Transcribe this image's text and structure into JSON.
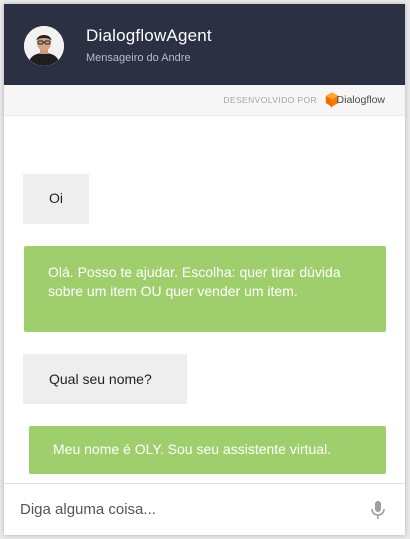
{
  "header": {
    "agent_name": "DialogflowAgent",
    "subtitle": "Mensageiro do Andre",
    "background_color": "#2b3142",
    "avatar_icon": "user-photo-avatar"
  },
  "powered_by": {
    "label": "DESENVOLVIDO POR",
    "brand": "Dialogflow",
    "brand_color": "#ef6c00"
  },
  "messages": [
    {
      "sender": "user",
      "text": "Oi"
    },
    {
      "sender": "bot",
      "text": "Olá. Posso te ajudar. Escolha: quer tirar dúvida sobre um item OU quer vender um item."
    },
    {
      "sender": "user",
      "text": "Qual seu nome?"
    },
    {
      "sender": "bot",
      "text": "Meu nome é OLY. Sou seu assistente virtual."
    }
  ],
  "colors": {
    "user_bubble": "#eeeeee",
    "bot_bubble": "#9fcf6d"
  },
  "input": {
    "placeholder": "Diga alguma coisa...",
    "value": "",
    "mic_icon": "microphone-icon"
  }
}
